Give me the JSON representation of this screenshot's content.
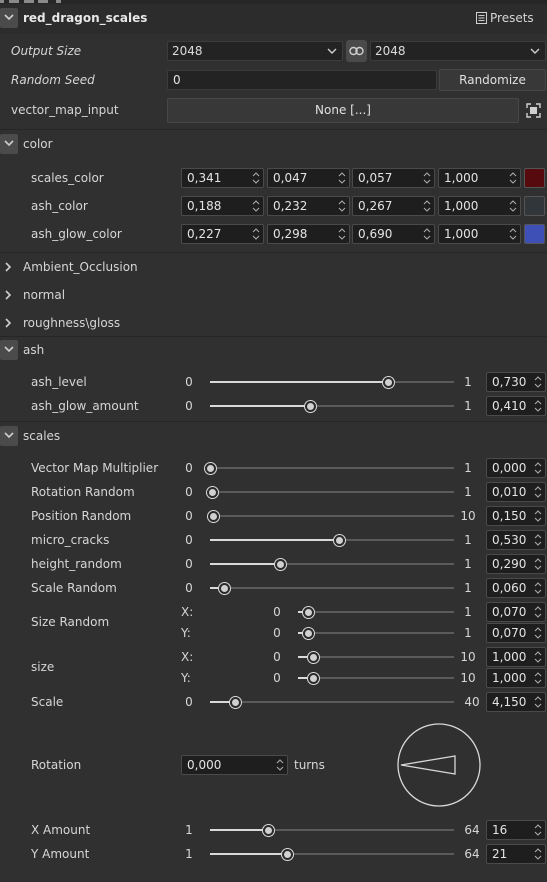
{
  "header": {
    "title": "red_dragon_scales",
    "presets_label": "Presets"
  },
  "output_size": {
    "label": "Output Size",
    "width": "2048",
    "height": "2048"
  },
  "random_seed": {
    "label": "Random Seed",
    "value": "0",
    "button": "Randomize"
  },
  "vector_map_input": {
    "label": "vector_map_input",
    "value": "None [...]"
  },
  "color_group": {
    "title": "color",
    "rows": [
      {
        "label": "scales_color",
        "r": "0,341",
        "g": "0,047",
        "b": "0,057",
        "a": "1,000",
        "swatch": "#570a0e"
      },
      {
        "label": "ash_color",
        "r": "0,188",
        "g": "0,232",
        "b": "0,267",
        "a": "1,000",
        "swatch": "#31363b"
      },
      {
        "label": "ash_glow_color",
        "r": "0,227",
        "g": "0,298",
        "b": "0,690",
        "a": "1,000",
        "swatch": "#3e4fb5"
      }
    ]
  },
  "collapsed_groups": [
    "Ambient_Occlusion",
    "normal",
    "roughness\\gloss"
  ],
  "ash_group": {
    "title": "ash",
    "rows": [
      {
        "label": "ash_level",
        "min": "0",
        "max": "1",
        "value": "0,730",
        "fraction": 0.73
      },
      {
        "label": "ash_glow_amount",
        "min": "0",
        "max": "1",
        "value": "0,410",
        "fraction": 0.41
      }
    ]
  },
  "scales_group": {
    "title": "scales",
    "rows": [
      {
        "label": "Vector Map Multiplier",
        "min": "0",
        "max": "1",
        "value": "0,000",
        "fraction": 0.0
      },
      {
        "label": "Rotation Random",
        "min": "0",
        "max": "1",
        "value": "0,010",
        "fraction": 0.01
      },
      {
        "label": "Position Random",
        "min": "0",
        "max": "10",
        "value": "0,150",
        "fraction": 0.015
      },
      {
        "label": "micro_cracks",
        "min": "0",
        "max": "1",
        "value": "0,530",
        "fraction": 0.53
      },
      {
        "label": "height_random",
        "min": "0",
        "max": "1",
        "value": "0,290",
        "fraction": 0.29
      },
      {
        "label": "Scale Random",
        "min": "0",
        "max": "1",
        "value": "0,060",
        "fraction": 0.06
      }
    ],
    "size_random": {
      "label": "Size Random",
      "x_label": "X:",
      "y_label": "Y:",
      "x": {
        "min": "0",
        "max": "1",
        "value": "0,070",
        "fraction": 0.07
      },
      "y": {
        "min": "0",
        "max": "1",
        "value": "0,070",
        "fraction": 0.07
      }
    },
    "size": {
      "label": "size",
      "x_label": "X:",
      "y_label": "Y:",
      "x": {
        "min": "0",
        "max": "10",
        "value": "1,000",
        "fraction": 0.1
      },
      "y": {
        "min": "0",
        "max": "10",
        "value": "1,000",
        "fraction": 0.1
      }
    },
    "scale": {
      "label": "Scale",
      "min": "0",
      "max": "40",
      "value": "4,150",
      "fraction": 0.104
    },
    "rotation": {
      "label": "Rotation",
      "value": "0,000",
      "unit": "turns"
    },
    "x_amount": {
      "label": "X Amount",
      "min": "1",
      "max": "64",
      "value": "16",
      "fraction": 0.238
    },
    "y_amount": {
      "label": "Y Amount",
      "min": "1",
      "max": "64",
      "value": "21",
      "fraction": 0.317
    }
  }
}
